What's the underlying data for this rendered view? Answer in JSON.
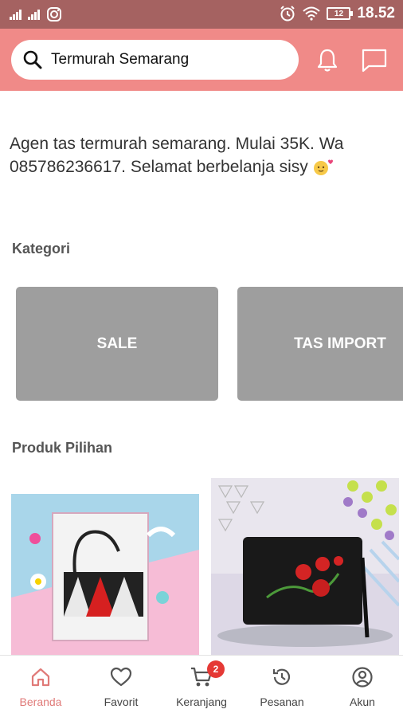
{
  "status_bar": {
    "time": "18.52",
    "battery": "12"
  },
  "search": {
    "value": "Termurah Semarang"
  },
  "shop": {
    "description": "Agen tas termurah semarang. Mulai 35K. Wa 085786236617. Selamat berbelanja sisy"
  },
  "sections": {
    "categories_title": "Kategori",
    "featured_title": "Produk Pilihan"
  },
  "categories": [
    {
      "label": "SALE"
    },
    {
      "label": "TAS IMPORT"
    }
  ],
  "products": [
    {
      "image": "black-white-red-bag-photo"
    },
    {
      "image": "black-embroidered-bag-photo"
    }
  ],
  "bottom_nav": {
    "items": [
      {
        "label": "Beranda",
        "icon": "home-icon",
        "active": true
      },
      {
        "label": "Favorit",
        "icon": "heart-icon"
      },
      {
        "label": "Keranjang",
        "icon": "cart-icon",
        "badge": "2"
      },
      {
        "label": "Pesanan",
        "icon": "history-icon"
      },
      {
        "label": "Akun",
        "icon": "account-icon"
      }
    ]
  },
  "colors": {
    "status_bar": "#a56261",
    "header": "#f08a88",
    "category_card": "#9e9e9e",
    "active_nav": "#e07a78",
    "badge": "#e53935"
  }
}
